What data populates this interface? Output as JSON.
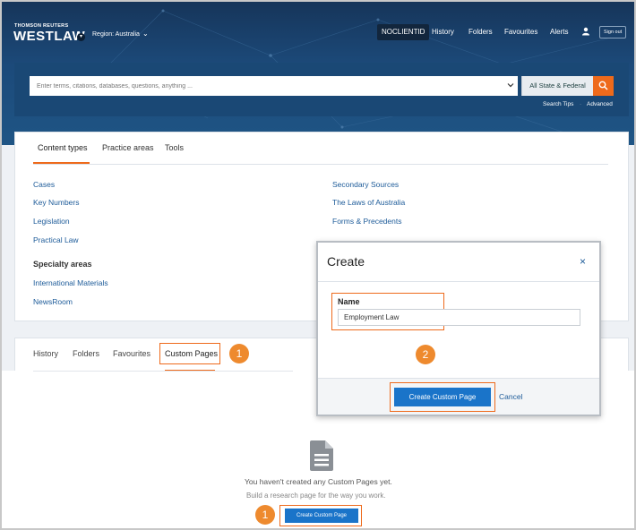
{
  "header": {
    "brand_top": "THOMSON REUTERS",
    "brand": "WESTLAW",
    "region": "Region: Australia",
    "nav": {
      "client": "NOCLIENTID",
      "history": "History",
      "folders": "Folders",
      "favourites": "Favourites",
      "alerts": "Alerts",
      "signout": "Sign out"
    }
  },
  "search": {
    "placeholder": "Enter terms, citations, databases, questions, anything ...",
    "jurisdiction": "All State & Federal",
    "tips": "Search Tips",
    "separator": "·",
    "advanced": "Advanced"
  },
  "browse": {
    "tabs": [
      "Content types",
      "Practice areas",
      "Tools"
    ],
    "left_links": [
      "Cases",
      "Key Numbers",
      "Legislation",
      "Practical Law"
    ],
    "right_links": [
      "Secondary Sources",
      "The Laws of Australia",
      "Forms & Precedents"
    ],
    "specialty_heading": "Specialty areas",
    "specialty_links": [
      "International Materials",
      "NewsRoom"
    ]
  },
  "lower": {
    "tabs": [
      "History",
      "Folders",
      "Favourites",
      "Custom Pages"
    ],
    "empty_title": "You haven't created any Custom Pages yet.",
    "empty_sub": "Build a research page for the way you work.",
    "create_button": "Create Custom Page"
  },
  "modal": {
    "title": "Create",
    "close": "×",
    "name_label": "Name",
    "name_value": "Employment Law",
    "create_button": "Create Custom Page",
    "cancel": "Cancel"
  },
  "callouts": {
    "tab_step": "1",
    "button_step": "1",
    "modal_step": "2"
  },
  "colors": {
    "accent": "#ee6a1b",
    "link": "#1d5b99",
    "primary_button": "#1a74c9",
    "header_bg": "#1c4a7a",
    "callout": "#ee8a2e"
  }
}
